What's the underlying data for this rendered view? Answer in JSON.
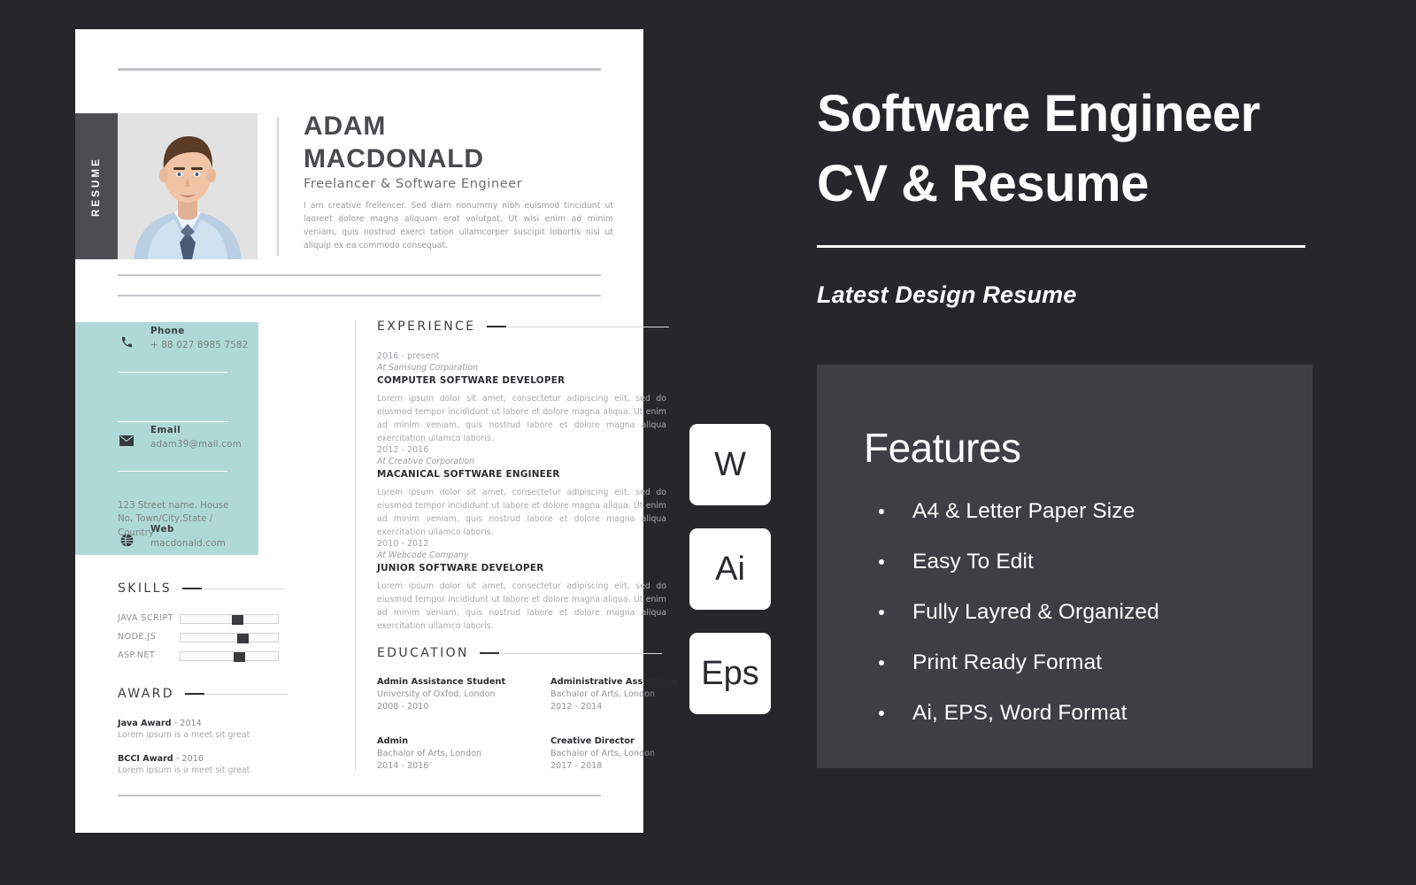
{
  "background_color": "#26262b",
  "accent_teal": "#aed9d7",
  "resume": {
    "side_tab_label": "RESUME",
    "name_line1": "ADAM",
    "name_line2": "MACDONALD",
    "job_title": "Freelancer & Software Engineer",
    "bio": "I am creative frellencer. Sed diam nonummy nibh euismod tincidunt ut laoreet dolore magna aliquam erat volutpat. Ut wisi enim ad minim veniam, quis nostrud exerci tation ullamcorper suscipit lobortis nisl ut aliquip ex ea commodo consequat.",
    "contact": [
      {
        "icon": "phone-icon",
        "label": "Phone",
        "value": "+ 88 027 8985 7582"
      },
      {
        "icon": "email-icon",
        "label": "Email",
        "value": "adam39@mail.com"
      },
      {
        "icon": "globe-icon",
        "label": "Web",
        "value": "macdonald.com"
      }
    ],
    "address": "123 Street name, House No, Town/City,State / Country",
    "skills_heading": "SKILLS",
    "skills": [
      {
        "name": "JAVA SCRIPT",
        "level": 60
      },
      {
        "name": "NODE.JS",
        "level": 66
      },
      {
        "name": "ASP.NET",
        "level": 62
      }
    ],
    "award_heading": "AWARD",
    "awards": [
      {
        "title": "Java Award",
        "year": "- 2014",
        "desc": "Lorem ipsum is a meet sit great"
      },
      {
        "title": "BCCI Award",
        "year": "- 2016",
        "desc": "Lorem ipsum is a meet sit great"
      }
    ],
    "experience_heading": "EXPERIENCE",
    "experience": [
      {
        "date": "2016 - present",
        "company": "At Samsung Corporation",
        "role": "COMPUTER SOFTWARE DEVELOPER",
        "desc": "Lorem ipsum dolor sit amet, consectetur adipiscing elit, sed do eiusmod tempor incididunt ut labore et dolore magna aliqua. Ut enim ad minim veniam, quis nostrud labore et dolore magna aliqua exercitation ullamco laboris."
      },
      {
        "date": "2012 - 2016",
        "company": "At Creative Corporation",
        "role": "MACANICAL SOFTWARE ENGINEER",
        "desc": "Lorem ipsum dolor sit amet, consectetur adipiscing elit, sed do eiusmod tempor incididunt ut labore et dolore magna aliqua. Ut enim ad minim veniam, quis nostrud labore et dolore magna aliqua exercitation ullamco laboris."
      },
      {
        "date": "2010 - 2012",
        "company": "At Webcode Company",
        "role": "JUNIOR SOFTWARE DEVELOPER",
        "desc": "Lorem ipsum dolor sit amet, consectetur adipiscing elit, sed do eiusmod tempor incididunt ut labore et dolore magna aliqua. Ut enim ad minim veniam, quis nostrud labore et dolore magna aliqua exercitation ullamco laboris."
      }
    ],
    "education_heading": "EDUCATION",
    "education": [
      {
        "title": "Admin Assistance Student",
        "school": "University of Oxfod, London",
        "years": "2008 - 2010"
      },
      {
        "title": "Administrative Assistance",
        "school": "Bachalor of Arts, London",
        "years": "2012 - 2014"
      },
      {
        "title": "Admin",
        "school": "Bachalor of Arts, London",
        "years": "2014 - 2016"
      },
      {
        "title": "Creative Director",
        "school": "Bachalor of Arts, London",
        "years": "2017 - 2018"
      }
    ]
  },
  "promo": {
    "title_line1": "Software Engineer",
    "title_line2": "CV &  Resume",
    "subtitle": "Latest Design Resume",
    "format_badges": [
      {
        "label": "W",
        "name": "word-format-badge"
      },
      {
        "label": "Ai",
        "name": "illustrator-format-badge"
      },
      {
        "label": "Eps",
        "name": "eps-format-badge"
      }
    ],
    "features_title": "Features",
    "features": [
      "A4 & Letter Paper Size",
      "Easy To Edit",
      "Fully Layred & Organized",
      "Print Ready Format",
      "Ai, EPS, Word Format"
    ]
  }
}
